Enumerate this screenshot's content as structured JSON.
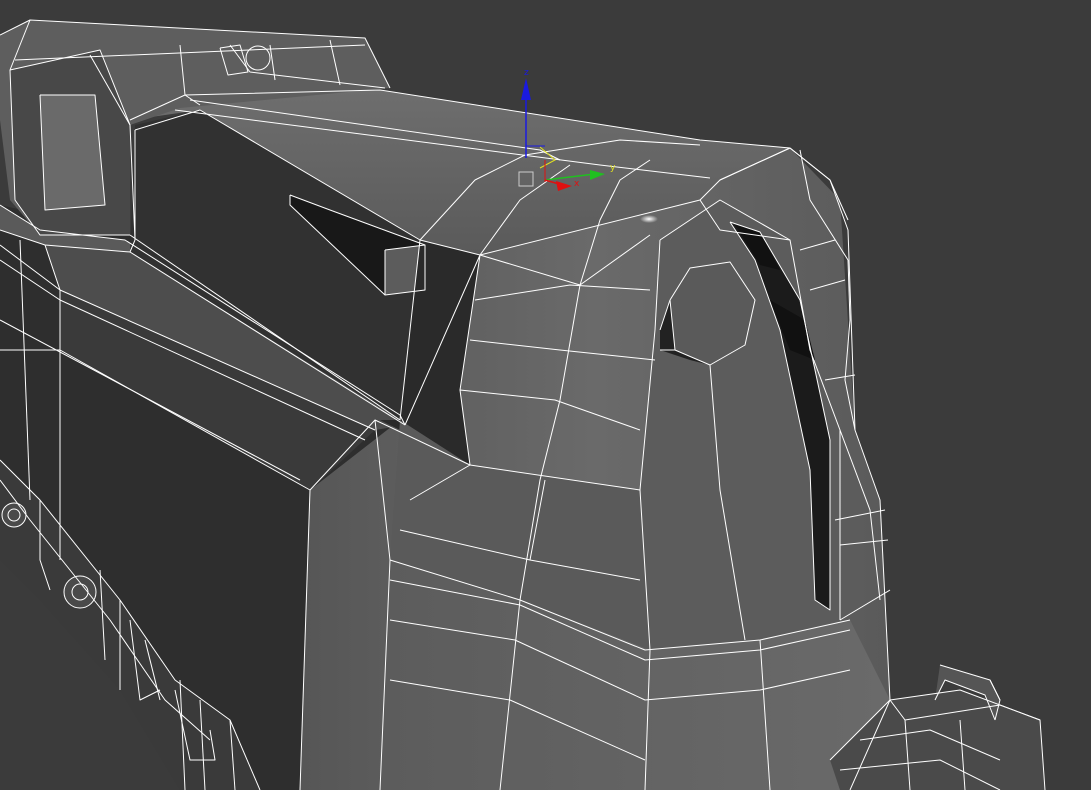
{
  "viewport": {
    "background_color": "#3b3b3b",
    "wire_color": "#ffffff",
    "model": "locomotive-nose-wireframe"
  },
  "gizmo": {
    "x_label": "x",
    "y_label": "y",
    "z_label": "z",
    "x_color": "#e01010",
    "y_color": "#20c020",
    "z_color": "#1a1ae0",
    "plane_color": "#e0e020"
  }
}
